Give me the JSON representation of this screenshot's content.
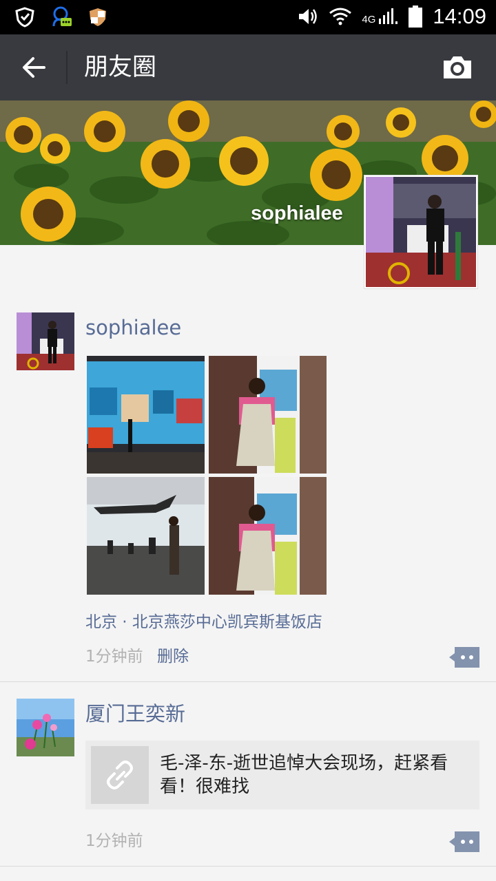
{
  "status_bar": {
    "network": "4G",
    "time": "14:09"
  },
  "header": {
    "title": "朋友圈"
  },
  "cover": {
    "user_name": "sophialee"
  },
  "posts": [
    {
      "author": "sophialee",
      "photo_count": 4,
      "location": "北京 · 北京燕莎中心凯宾斯基饭店",
      "time": "1分钟前",
      "delete_label": "删除"
    },
    {
      "author": "厦门王奕新",
      "link_title": "毛-泽-东-逝世追悼大会现场，赶紧看看！很难找",
      "time": "1分钟前"
    }
  ],
  "colors": {
    "status_bar_bg": "#000000",
    "title_bar_bg": "#393a3f",
    "nickname_blue": "#576b95",
    "timestamp_gray": "#b2b2b2",
    "page_bg": "#f4f4f4",
    "link_card_bg": "#ebebeb"
  },
  "icons": {
    "status_left": [
      "shield-check-icon",
      "chat-assistant-icon",
      "security-badge-icon"
    ],
    "status_right": [
      "volume-icon",
      "wifi-icon",
      "signal-icon",
      "battery-icon"
    ],
    "header": [
      "back-arrow-icon",
      "camera-icon"
    ],
    "post": [
      "comment-dots-icon",
      "link-icon"
    ]
  }
}
